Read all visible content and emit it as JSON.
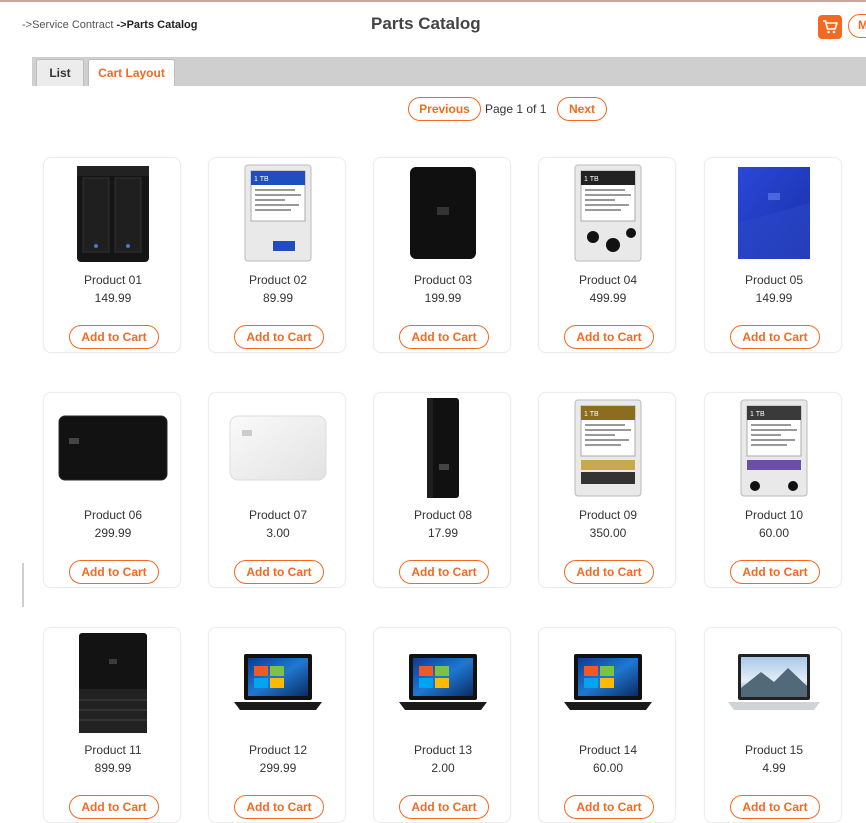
{
  "breadcrumb": {
    "parent": "Service Contract",
    "separator_a": "->",
    "separator_b": " ->",
    "current": "Parts Catalog"
  },
  "page": {
    "title": "Parts Catalog"
  },
  "header": {
    "more_label": "M"
  },
  "tabs": [
    {
      "label": "List"
    },
    {
      "label": "Cart Layout"
    }
  ],
  "pager": {
    "previous_label": "Previous",
    "page_text": "Page 1 of 1",
    "next_label": "Next"
  },
  "colors": {
    "accent": "#f26a21",
    "tab_bar": "#cfcfcf"
  },
  "add_label": "Add to Cart",
  "products": [
    {
      "name": "Product 01",
      "price": "149.99",
      "icon": "nas-drive-icon"
    },
    {
      "name": "Product 02",
      "price": "89.99",
      "icon": "internal-hdd-blue-icon"
    },
    {
      "name": "Product 03",
      "price": "199.99",
      "icon": "portable-drive-icon"
    },
    {
      "name": "Product 04",
      "price": "499.99",
      "icon": "internal-hdd-black-icon"
    },
    {
      "name": "Product 05",
      "price": "149.99",
      "icon": "portable-drive-blue-icon"
    },
    {
      "name": "Product 06",
      "price": "299.99",
      "icon": "external-drive-black-icon"
    },
    {
      "name": "Product 07",
      "price": "3.00",
      "icon": "portable-drive-white-icon"
    },
    {
      "name": "Product 08",
      "price": "17.99",
      "icon": "desktop-drive-icon"
    },
    {
      "name": "Product 09",
      "price": "350.00",
      "icon": "internal-hdd-gold-icon"
    },
    {
      "name": "Product 10",
      "price": "60.00",
      "icon": "internal-hdd-purple-icon"
    },
    {
      "name": "Product 11",
      "price": "899.99",
      "icon": "dual-bay-drive-icon"
    },
    {
      "name": "Product 12",
      "price": "299.99",
      "icon": "laptop-icon"
    },
    {
      "name": "Product 13",
      "price": "2.00",
      "icon": "laptop-icon"
    },
    {
      "name": "Product 14",
      "price": "60.00",
      "icon": "laptop-icon"
    },
    {
      "name": "Product 15",
      "price": "4.99",
      "icon": "laptop-silver-icon"
    }
  ]
}
